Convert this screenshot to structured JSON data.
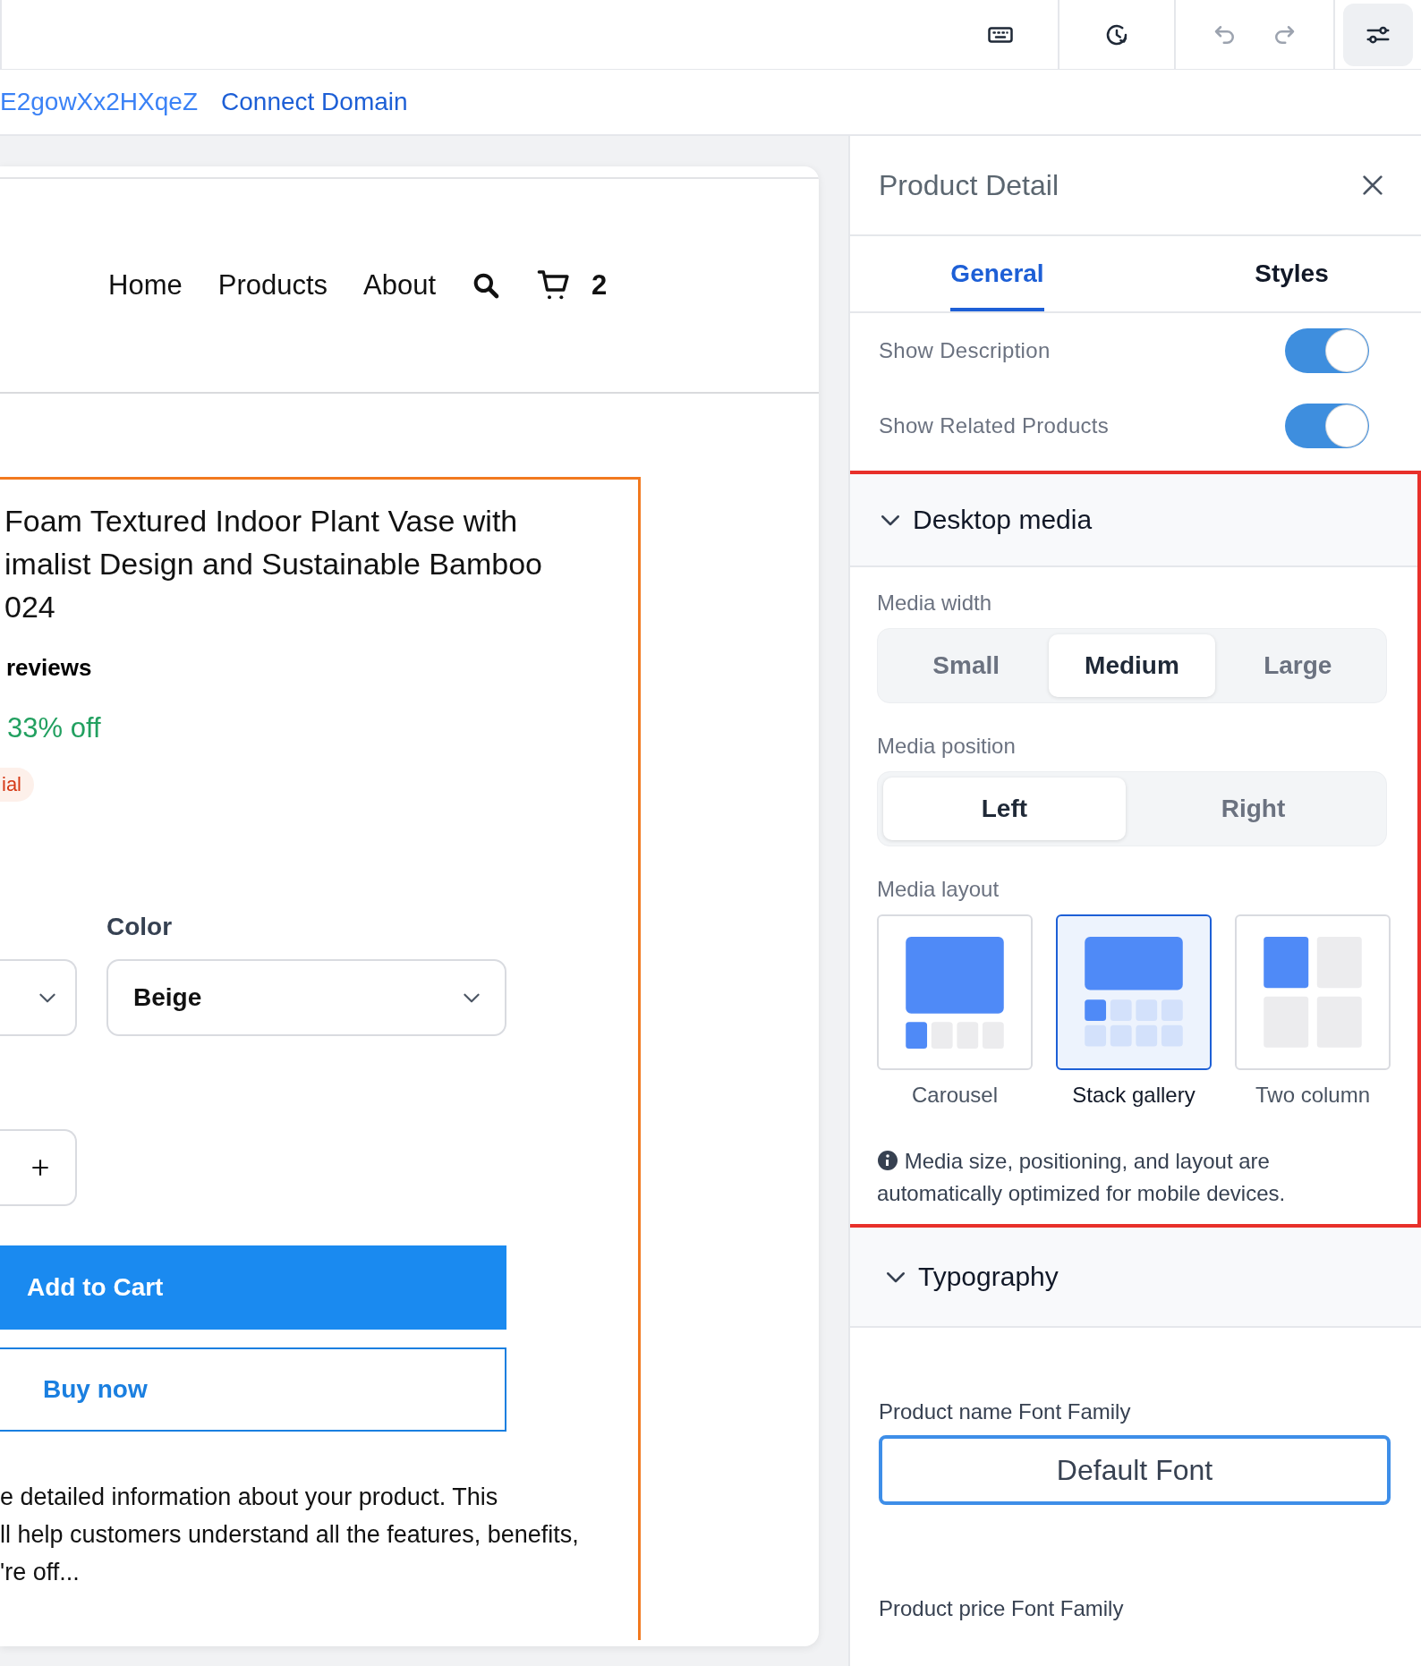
{
  "address_bar": {
    "site_id": "E2gowXx2HXqeZ",
    "link": "Connect Domain"
  },
  "preview": {
    "nav": [
      {
        "label": "Home"
      },
      {
        "label": "Products"
      },
      {
        "label": "About"
      }
    ],
    "cart_count": "2",
    "product": {
      "title_lines": [
        "Foam Textured Indoor Plant Vase with",
        "imalist Design and Sustainable Bamboo",
        "024"
      ],
      "reviews": "reviews",
      "discount": "33% off",
      "badge": "ial",
      "selects": [
        {
          "kind": "cut"
        },
        {
          "kind": "full",
          "label": "Color",
          "value": "Beige"
        }
      ],
      "add_to_cart": "Add to Cart",
      "buy_now": "Buy now",
      "description_lines": [
        "e detailed information about your product. This",
        "ll help customers understand all the features, benefits,",
        "'re off..."
      ]
    }
  },
  "panel": {
    "title": "Product Detail",
    "tabs": [
      {
        "label": "General",
        "selected": true
      },
      {
        "label": "Styles",
        "selected": false
      }
    ],
    "toggles": [
      {
        "label": "Show Description",
        "on": true
      },
      {
        "label": "Show Related Products",
        "on": true
      }
    ],
    "desktop_media": {
      "title": "Desktop media",
      "expanded": true,
      "highlighted": true,
      "media_width": {
        "label": "Media width",
        "options": [
          {
            "label": "Small",
            "selected": false
          },
          {
            "label": "Medium",
            "selected": true
          },
          {
            "label": "Large",
            "selected": false
          }
        ]
      },
      "media_position": {
        "label": "Media position",
        "options": [
          {
            "label": "Left",
            "selected": true
          },
          {
            "label": "Right",
            "selected": false
          }
        ]
      },
      "media_layout": {
        "label": "Media layout",
        "options": [
          {
            "kind": "carousel",
            "label": "Carousel",
            "selected": false
          },
          {
            "kind": "stack",
            "label": "Stack gallery",
            "selected": true
          },
          {
            "kind": "two_column",
            "label": "Two column",
            "selected": false
          }
        ]
      },
      "note": "Media size, positioning, and layout are automatically optimized for mobile devices."
    },
    "typography": {
      "title": "Typography",
      "expanded": true,
      "fields": [
        {
          "label": "Product name Font Family",
          "value": "Default Font"
        }
      ],
      "next_label": "Product price Font Family"
    }
  }
}
